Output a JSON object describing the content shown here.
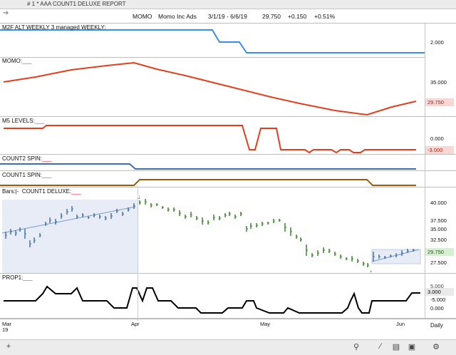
{
  "window": {
    "title": "# 1 *   AAA COUNT1 DELUXE REPORT"
  },
  "header": {
    "symbol": "MOMO",
    "name": "Momo Inc Ads",
    "range": "3/1/19 - 6/6/19",
    "last": "29.750",
    "change": "+0.150",
    "pct": "+0.51%"
  },
  "panes": {
    "m2f": {
      "label": "M2F ALT WEEKLY 3 managed WEEKLY:",
      "tick": "2.000"
    },
    "momo": {
      "label": "MOMO:",
      "tick": "35.000",
      "badge": "29.750"
    },
    "m5": {
      "label": "M5 LEVELS:",
      "tick": "0.000",
      "badge": "-3.000"
    },
    "count2": {
      "label": "COUNT2 SPIN:"
    },
    "count1": {
      "label": "COUNT1 SPIN:"
    },
    "bars": {
      "label_prefix": "Bars:|-",
      "label": "COUNT1 DELUXE:",
      "ticks": [
        "40.000",
        "37.500",
        "35.000",
        "32.500",
        "27.500"
      ],
      "badge": "29.750"
    },
    "prop1": {
      "label": "PROP1:",
      "ticks": [
        "5.000",
        "3.000",
        "-5.000",
        "0.000"
      ]
    }
  },
  "xaxis": {
    "labels": [
      "Mar",
      "Apr",
      "May",
      "Jun"
    ],
    "year": "19",
    "period": "Daily"
  },
  "colors": {
    "m2f": "#3a8ee6",
    "momo": "#e0401e",
    "m5": "#e0401e",
    "count2": "#3d6fb0",
    "count1": "#9a5a10",
    "bars_blue": "#3b6ea8",
    "bars_green": "#2e7d1e",
    "prop1": "#000000",
    "badge_red": "#f8d8d6",
    "badge_green": "#d8efd3"
  },
  "bottom_icons": [
    "add-icon",
    "search-icon",
    "line-tool-icon",
    "chart-icon",
    "toggle-icon",
    "settings-icon"
  ],
  "chart_data": [
    {
      "type": "line",
      "title": "M2F ALT WEEKLY 3 managed WEEKLY",
      "series": [
        {
          "values": [
            2.0,
            2.0,
            2.0,
            2.0,
            2.0,
            2.0,
            1.0,
            1.0,
            0.0,
            0.0,
            0.0,
            0.0
          ]
        }
      ]
    },
    {
      "type": "line",
      "title": "MOMO",
      "ylim": [
        28,
        37
      ],
      "series": [
        {
          "values": [
            35.0,
            35.6,
            36.2,
            36.6,
            36.9,
            35.8,
            34.6,
            33.3,
            31.8,
            30.5,
            29.3,
            29.75
          ]
        }
      ]
    },
    {
      "type": "line",
      "title": "M5 LEVELS",
      "series": [
        {
          "values": [
            0,
            0,
            0,
            0,
            0,
            0,
            -3,
            0,
            -3,
            -3,
            -3,
            -3
          ]
        }
      ]
    },
    {
      "type": "line",
      "title": "COUNT1 DELUXE",
      "x": [
        "Mar",
        "Apr",
        "May",
        "Jun"
      ],
      "ylim": [
        26,
        42
      ]
    },
    {
      "type": "line",
      "title": "PROP1",
      "series": [
        {
          "values": [
            3,
            0,
            3,
            3,
            0,
            0,
            3,
            0,
            -5,
            0,
            -5,
            3
          ]
        }
      ]
    }
  ]
}
